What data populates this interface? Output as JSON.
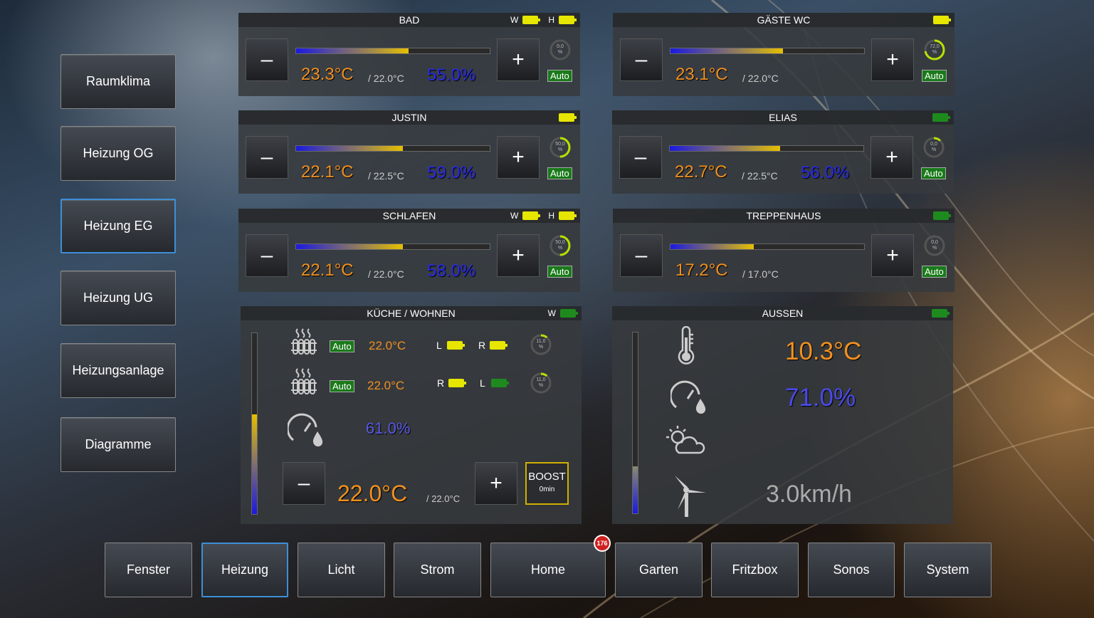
{
  "colors": {
    "accent": "#3d8fd8",
    "temp": "#f09020",
    "humidity": "#2a2ae8",
    "auto": "#1a7a1a",
    "battery": "#e6e600"
  },
  "sidebar": {
    "items": [
      {
        "label": "Raumklima"
      },
      {
        "label": "Heizung OG"
      },
      {
        "label": "Heizung EG",
        "active": true
      },
      {
        "label": "Heizung UG"
      },
      {
        "label": "Heizungsanlage"
      },
      {
        "label": "Diagramme"
      }
    ]
  },
  "bottom_nav": {
    "items": [
      {
        "label": "Fenster"
      },
      {
        "label": "Heizung",
        "active": true
      },
      {
        "label": "Licht"
      },
      {
        "label": "Strom"
      },
      {
        "label": "Home",
        "badge": "176"
      },
      {
        "label": "Garten"
      },
      {
        "label": "Fritzbox"
      },
      {
        "label": "Sonos"
      },
      {
        "label": "System"
      }
    ]
  },
  "rooms": [
    {
      "name": "BAD",
      "w_label": "W",
      "h_label": "H",
      "temp": "23.3°C",
      "setpoint": "/ 22.0°C",
      "humidity": "55.0%",
      "valve": "0,0",
      "valve_pct": "%",
      "valve_fraction": 0.0,
      "mode": "Auto",
      "level": 0.58
    },
    {
      "name": "GÄSTE WC",
      "temp": "23.1°C",
      "setpoint": "/ 22.0°C",
      "valve": "72,0",
      "valve_pct": "%",
      "valve_fraction": 0.72,
      "mode": "Auto",
      "level": 0.58
    },
    {
      "name": "JUSTIN",
      "temp": "22.1°C",
      "setpoint": "/ 22.5°C",
      "humidity": "59.0%",
      "valve": "50,0",
      "valve_pct": "%",
      "valve_fraction": 0.5,
      "mode": "Auto",
      "level": 0.55
    },
    {
      "name": "ELIAS",
      "temp": "22.7°C",
      "setpoint": "/ 22.5°C",
      "humidity": "56.0%",
      "valve": "0,0",
      "valve_pct": "%",
      "valve_fraction": 0.12,
      "mode": "Auto",
      "level": 0.57
    },
    {
      "name": "SCHLAFEN",
      "w_label": "W",
      "h_label": "H",
      "temp": "22.1°C",
      "setpoint": "/ 22.0°C",
      "humidity": "58.0%",
      "valve": "50,0",
      "valve_pct": "%",
      "valve_fraction": 0.5,
      "mode": "Auto",
      "level": 0.55
    },
    {
      "name": "TREPPENHAUS",
      "temp": "17.2°C",
      "setpoint": "/ 17.0°C",
      "valve": "0,0",
      "valve_pct": "%",
      "valve_fraction": 0.0,
      "mode": "Auto",
      "level": 0.43
    }
  ],
  "kitchen": {
    "name": "KÜCHE / WOHNEN",
    "w_label": "W",
    "rad1": {
      "mode": "Auto",
      "setpoint": "22.0°C",
      "l": "L",
      "r": "R",
      "valve": "11,0",
      "valve_pct": "%",
      "valve_fraction": 0.11
    },
    "rad2": {
      "mode": "Auto",
      "setpoint": "22.0°C",
      "r": "R",
      "l": "L",
      "valve": "11,0",
      "valve_pct": "%",
      "valve_fraction": 0.11
    },
    "humidity": "61.0%",
    "temp": "22.0°C",
    "setpoint": "/ 22.0°C",
    "boost_label": "BOOST",
    "boost_time": "0min",
    "level": 0.55
  },
  "outside": {
    "name": "AUSSEN",
    "temp": "10.3°C",
    "humidity": "71.0%",
    "wind": "3.0km/h",
    "level": 0.26
  },
  "icons": [
    "radiator-icon",
    "humidity-gauge-icon",
    "thermometer-icon",
    "weather-icon",
    "wind-turbine-icon",
    "battery-icon"
  ]
}
